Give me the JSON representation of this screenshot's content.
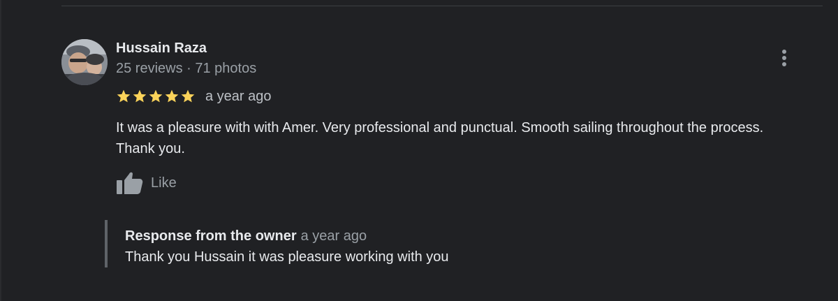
{
  "review": {
    "reviewer_name": "Hussain Raza",
    "reviewer_meta": "25 reviews · 71 photos",
    "rating": 5,
    "rating_max": 5,
    "star_color": "#fbd35a",
    "time_ago": "a year ago",
    "text": "It was a pleasure with with Amer. Very professional and punctual. Smooth sailing throughout the process. Thank you.",
    "like_label": "Like",
    "more_icon": "more-vertical-icon",
    "like_icon": "thumbs-up-icon"
  },
  "owner_response": {
    "title": "Response from the owner",
    "time_ago": "a year ago",
    "text": "Thank you Hussain it was pleasure working with you"
  }
}
